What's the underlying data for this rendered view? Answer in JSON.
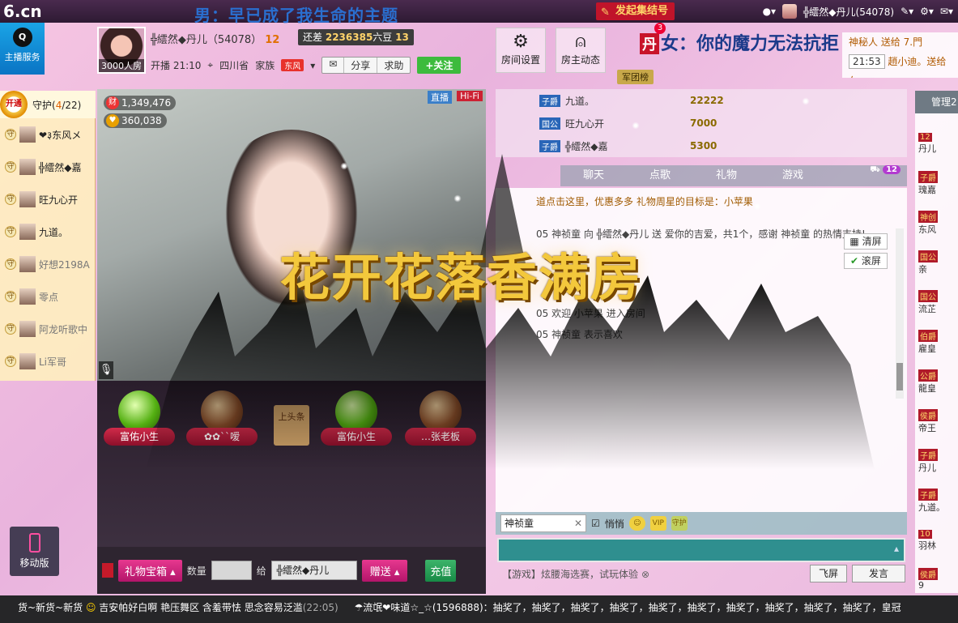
{
  "topbar": {
    "logo": "6.cn",
    "scroll_text": "男：早已成了我生命的主题",
    "clan_button": "发起集结号",
    "user_name": "╬繧然◆丹儿(54078)"
  },
  "header": {
    "host_service": "主播服务",
    "viewer_count": "3000人房",
    "host_name": "╬繧然◆丹儿（54078）",
    "host_level": "12",
    "need_label": "还差",
    "need_value": "2236385",
    "need_unit": "六豆",
    "need_level": "13",
    "start_time": "开播 21:10",
    "location": "四川省",
    "family_label": "家族",
    "family_tag": "东风",
    "share": "分享",
    "help": "求助",
    "follow": "+关注",
    "room_settings": "房间设置",
    "host_feed": "房主动态",
    "army_tab": "军团榜",
    "female_line_tag": "丹",
    "female_line": "女：你的魔力无法抗拒",
    "notify_badge": "3",
    "notice_1": "神秘人 送给 7.門",
    "notice_2_time": "21:53",
    "notice_2": "趙小迪。送给 久"
  },
  "guard": {
    "open_label": "开通",
    "title": "守护(",
    "count": "4",
    "total": "/22)",
    "items": [
      {
        "name": "❤३东风メ",
        "online": true
      },
      {
        "name": "╬繧然◆嘉",
        "online": true
      },
      {
        "name": "旺九心开",
        "online": true
      },
      {
        "name": "九道。",
        "online": true
      },
      {
        "name": "好想2198A",
        "online": false
      },
      {
        "name": "零点",
        "online": false
      },
      {
        "name": "阿龙听歌中",
        "online": false
      },
      {
        "name": "Li军哥",
        "online": false
      }
    ]
  },
  "video": {
    "wealth": "1,349,476",
    "fans": "360,038",
    "live_badge": "直播",
    "hifi_badge": "Hi-Fi"
  },
  "effect_text": "花开花落香满房",
  "gift_stage": {
    "pedestals": [
      "富佑小生",
      "✿✿``嗳",
      "富佑小生",
      "…张老板"
    ],
    "board": "上头条"
  },
  "giftbar": {
    "giftbox": "礼物宝箱",
    "qty_label": "数量",
    "to_label": "给",
    "recipient": "╬繧然◆丹儿",
    "send": "赠送",
    "charge": "充值"
  },
  "ranking": [
    {
      "badge": "子爵",
      "name": "九道。",
      "coins": "22222"
    },
    {
      "badge": "国公",
      "name": "旺九心开",
      "coins": "7000"
    },
    {
      "badge": "子爵",
      "name": "╬繧然◆嘉",
      "coins": "5300"
    }
  ],
  "chat": {
    "tabs": [
      "聊天",
      "点歌",
      "礼物",
      "游戏"
    ],
    "guest_count": "12",
    "promo": "道点击这里，优惠多多    礼物周星的目标是：小苹果",
    "msg1": "05 神祯童 向 ╬繧然◆丹儿 送 爱你的吉爱，共1个，感谢 神祯童 的热情支持!",
    "msg2": "05 欢迎 小苹果 进入房间",
    "msg3": "05 神祯童 表示喜欢",
    "clear": "清屏",
    "scroll": "滚屏",
    "target": "神祯童",
    "quiet": "悄悄",
    "vip": "VIP",
    "guard": "守护",
    "game_note": "【游戏】炫腰海选赛，试玩体验",
    "fly": "飞屏",
    "send": "发言"
  },
  "manage": {
    "title": "管理2",
    "rows": [
      {
        "badge": "12",
        "text": "丹儿"
      },
      {
        "badge": "子爵",
        "text": "瑰嘉"
      },
      {
        "badge": "神创",
        "text": "东风"
      },
      {
        "badge": "国公",
        "text": "亲"
      },
      {
        "badge": "国公",
        "text": "流芷"
      },
      {
        "badge": "伯爵",
        "text": "雇皇"
      },
      {
        "badge": "公爵",
        "text": "龍皇"
      },
      {
        "badge": "侯爵",
        "text": "帝王"
      },
      {
        "badge": "子爵",
        "text": "丹儿"
      },
      {
        "badge": "子爵",
        "text": "九道。"
      },
      {
        "badge": "10",
        "text": "羽林"
      },
      {
        "badge": "侯爵",
        "text": "9"
      }
    ]
  },
  "mobile": "移动版",
  "ticker": {
    "part1": "货~新货~新货",
    "part2": "吉安帕好白啊 艳压舞区 含羞带怯 思念容易泛滥",
    "time": "(22:05)",
    "part3": "☂流氓❤味道☆_☆(1596888)：抽奖了，抽奖了，抽奖了，抽奖了，抽奖了，抽奖了，抽奖了，抽奖了，抽奖了，抽奖了，皇冠"
  }
}
